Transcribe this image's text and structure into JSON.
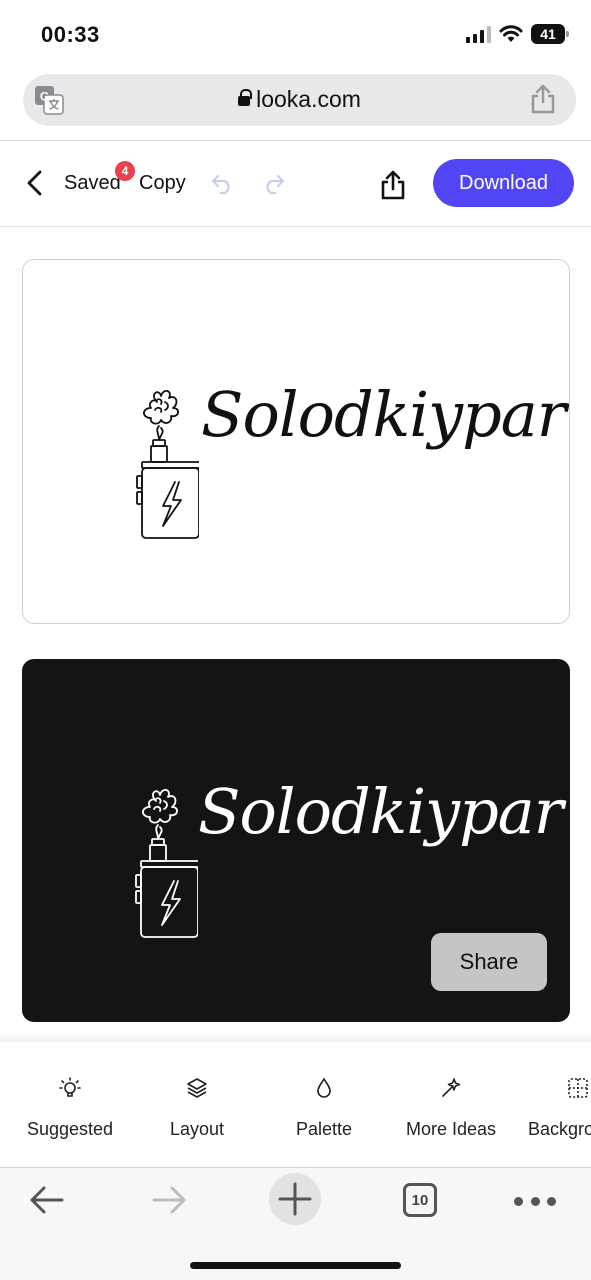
{
  "status_bar": {
    "time": "00:33",
    "battery": "41"
  },
  "browser": {
    "url": "looka.com",
    "tab_count": "10"
  },
  "toolbar": {
    "saved_label": "Saved",
    "saved_badge": "4",
    "copy_label": "Copy",
    "download_label": "Download"
  },
  "logo": {
    "name": "Solodkiypar"
  },
  "preview": {
    "share_label": "Share"
  },
  "tools": [
    {
      "label": "Suggested",
      "icon": "lightbulb-icon"
    },
    {
      "label": "Layout",
      "icon": "layers-icon"
    },
    {
      "label": "Palette",
      "icon": "droplet-icon"
    },
    {
      "label": "More Ideas",
      "icon": "magic-wand-icon"
    },
    {
      "label": "Backgro",
      "icon": "grid-icon"
    }
  ],
  "colors": {
    "accent": "#5145f5",
    "badge": "#e8434c",
    "dark_card": "#141414"
  }
}
